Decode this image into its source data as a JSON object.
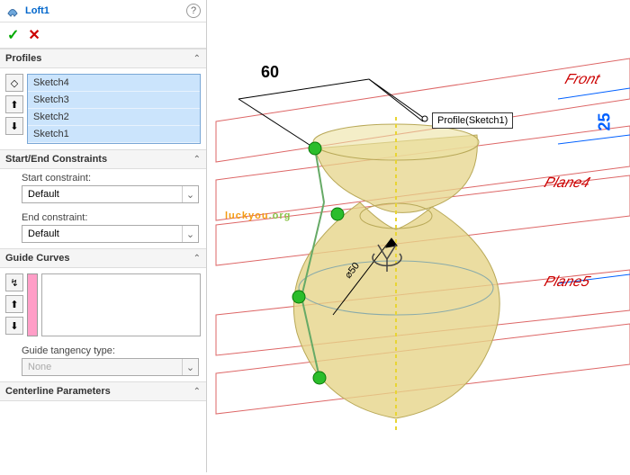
{
  "header": {
    "title": "Loft1"
  },
  "confirm": {
    "ok": "✓",
    "cancel": "✕"
  },
  "sections": {
    "profiles": {
      "title": "Profiles",
      "items": [
        "Sketch4",
        "Sketch3",
        "Sketch2",
        "Sketch1"
      ]
    },
    "constraints": {
      "title": "Start/End Constraints",
      "start_label": "Start constraint:",
      "start_value": "Default",
      "end_label": "End constraint:",
      "end_value": "Default"
    },
    "guides": {
      "title": "Guide Curves",
      "tangency_label": "Guide tangency type:",
      "tangency_value": "None"
    },
    "centerline": {
      "title": "Centerline Parameters"
    }
  },
  "icons": {
    "diamond": "◇",
    "up": "⬆",
    "down": "⬇",
    "curve": "↯",
    "chev_down": "⌃",
    "dd": "⌄"
  },
  "viewport": {
    "profile_label": "Profile(Sketch1)",
    "dim60": "60",
    "dim25": "25",
    "diam": "⌀50",
    "planes": {
      "front": "Front",
      "plane4": "Plane4",
      "plane5": "Plane5"
    },
    "watermark_a": "luckyou",
    "watermark_b": ".org"
  }
}
